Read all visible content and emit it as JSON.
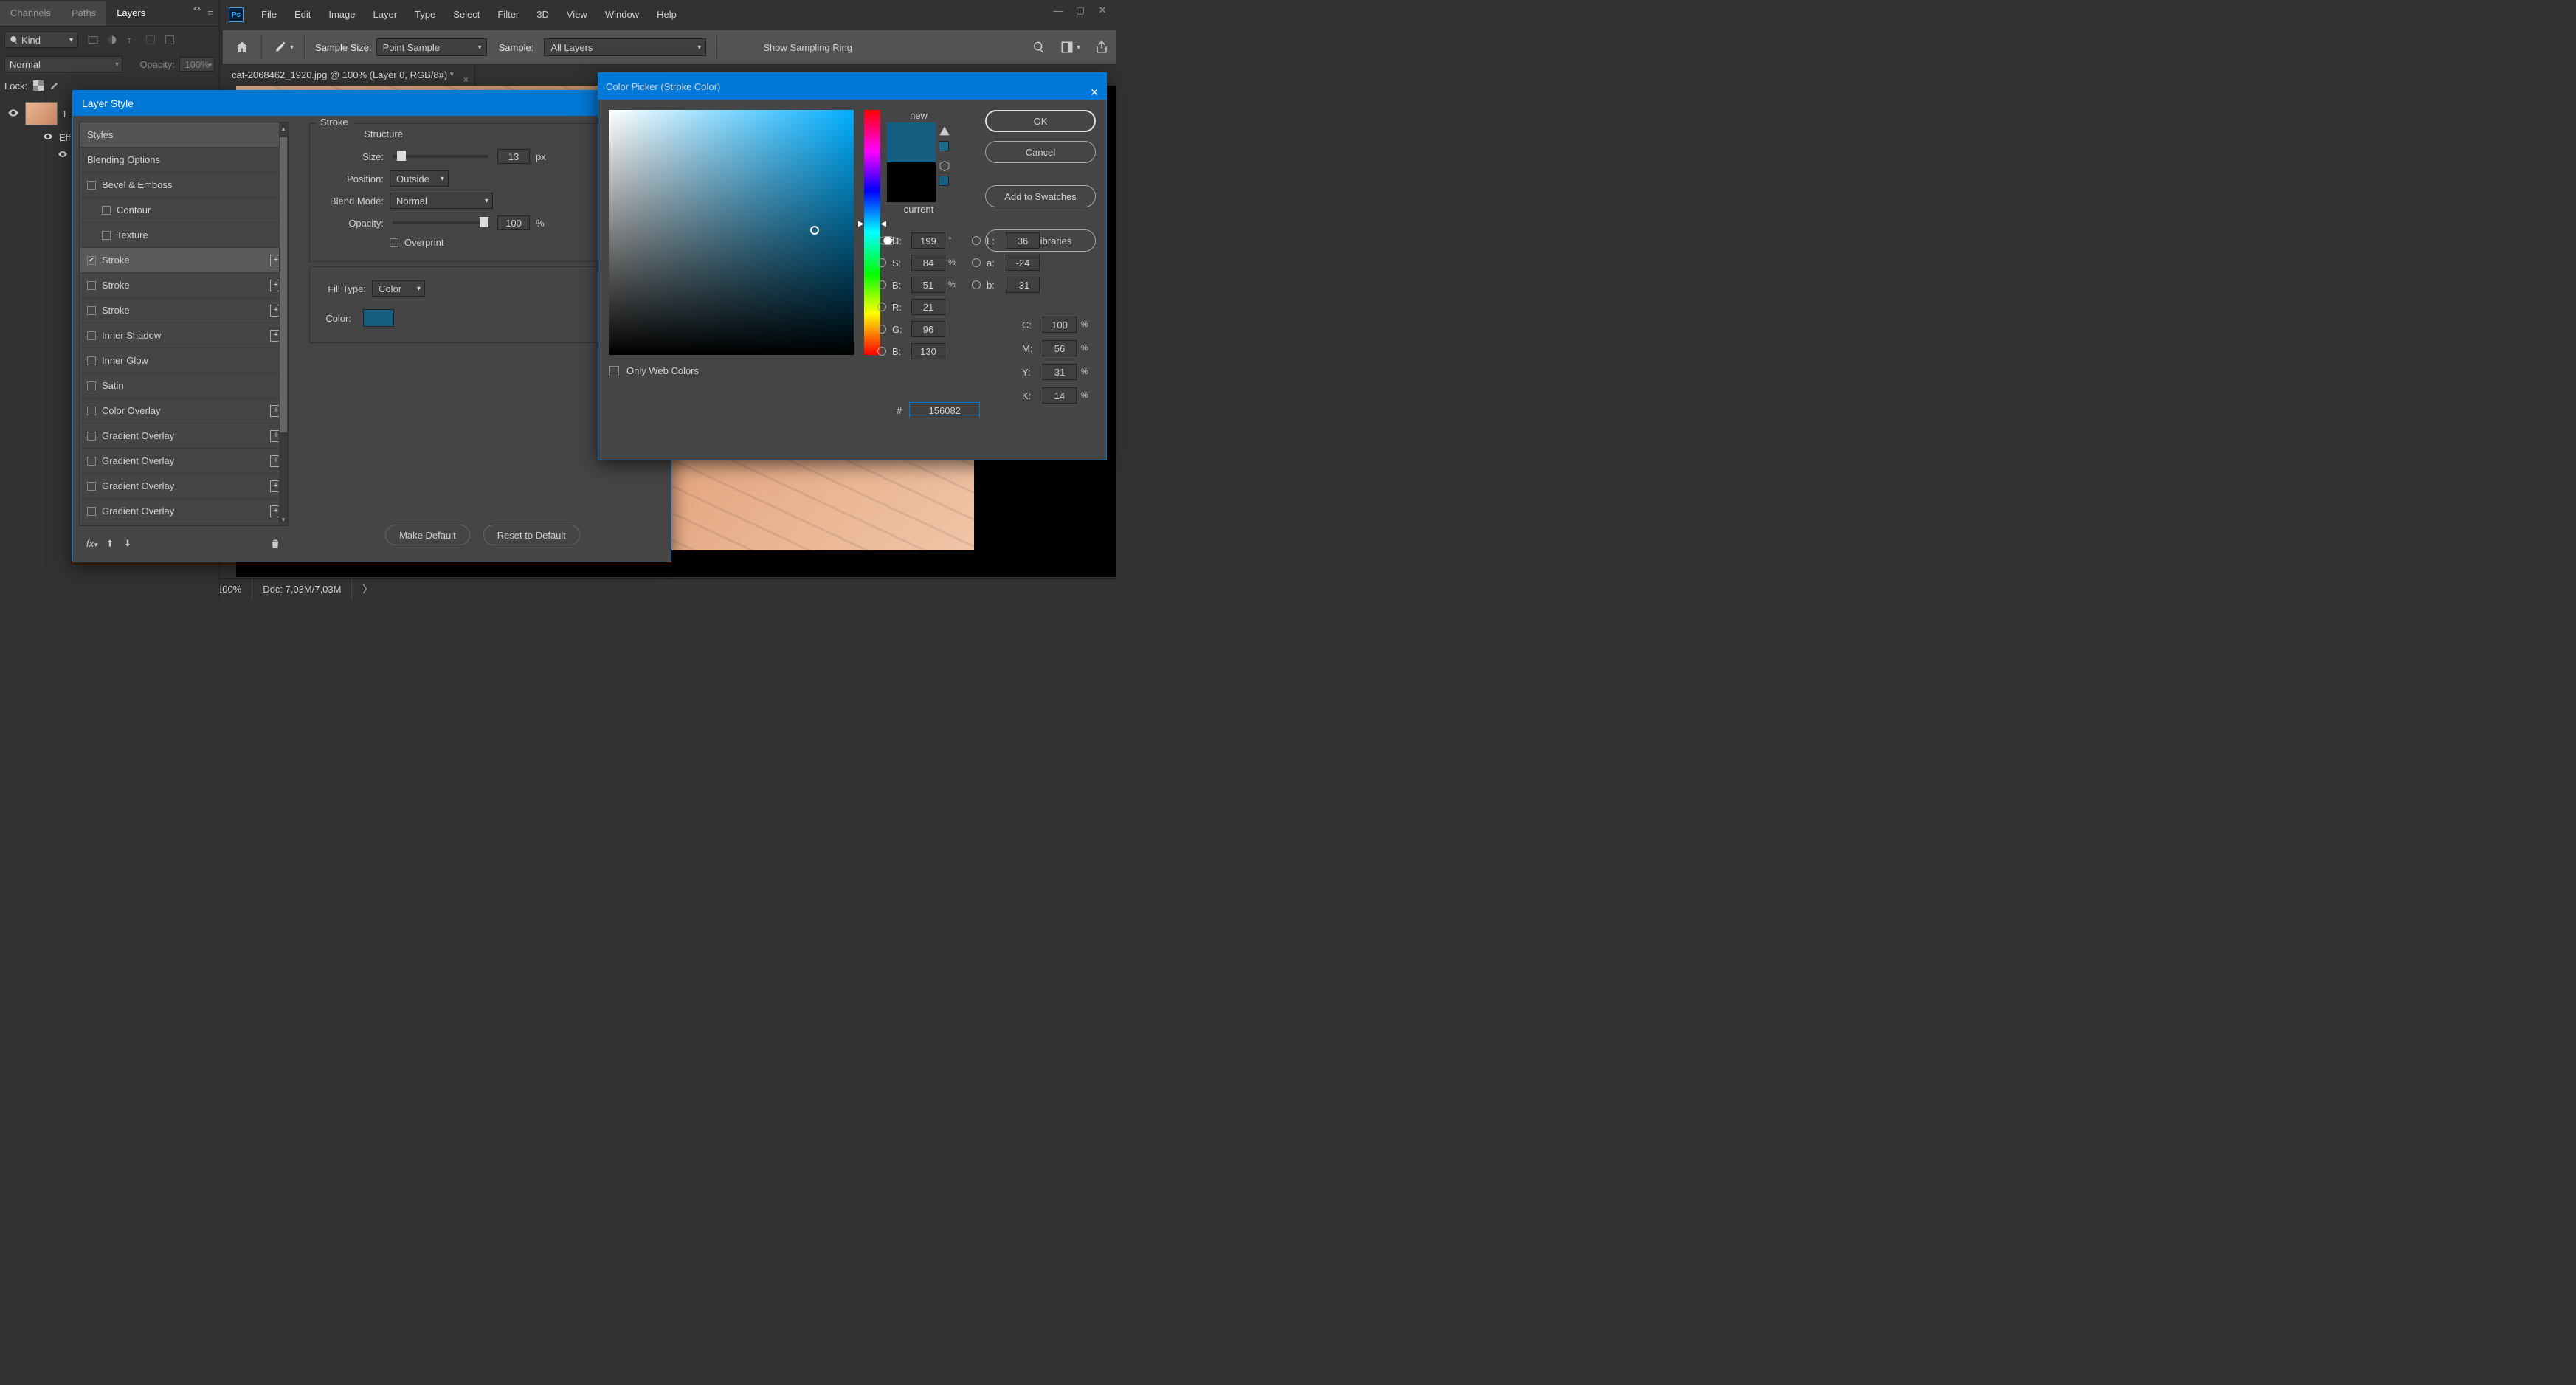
{
  "menu": [
    "File",
    "Edit",
    "Image",
    "Layer",
    "Type",
    "Select",
    "Filter",
    "3D",
    "View",
    "Window",
    "Help"
  ],
  "ps_logo": "Ps",
  "toolbar": {
    "sample_size_label": "Sample Size:",
    "sample_size_value": "Point Sample",
    "sample_label": "Sample:",
    "sample_value": "All Layers",
    "show_ring": "Show Sampling Ring"
  },
  "doc_tab": "cat-2068462_1920.jpg @ 100% (Layer 0, RGB/8#) *",
  "status": {
    "zoom": "100%",
    "docinfo": "Doc: 7,03M/7,03M"
  },
  "panel": {
    "tabs": [
      "Channels",
      "Paths",
      "Layers"
    ],
    "active_tab": "Layers",
    "kind": "Kind",
    "blend_mode": "Normal",
    "opacity_label": "Opacity:",
    "opacity_value": "100%",
    "lock_label": "Lock:",
    "layer0": "L",
    "effects": "Eff",
    "sub_eye": ""
  },
  "layer_style": {
    "title": "Layer Style",
    "stroke_header": "Stroke",
    "structure_header": "Structure",
    "size_label": "Size:",
    "size_value": "13",
    "size_unit": "px",
    "position_label": "Position:",
    "position_value": "Outside",
    "blend_label": "Blend Mode:",
    "blend_value": "Normal",
    "opacity_label": "Opacity:",
    "opacity_value": "100",
    "opacity_unit": "%",
    "overprint": "Overprint",
    "fill_type_label": "Fill Type:",
    "fill_type_value": "Color",
    "color_label": "Color:",
    "make_default": "Make Default",
    "reset_default": "Reset to Default",
    "sidebar": {
      "styles": "Styles",
      "blending_options": "Blending Options",
      "items": [
        {
          "label": "Bevel & Emboss",
          "checked": false,
          "plus": false,
          "indent": false
        },
        {
          "label": "Contour",
          "checked": false,
          "plus": false,
          "indent": true
        },
        {
          "label": "Texture",
          "checked": false,
          "plus": false,
          "indent": true
        },
        {
          "label": "Stroke",
          "checked": true,
          "plus": true,
          "indent": false,
          "active": true
        },
        {
          "label": "Stroke",
          "checked": false,
          "plus": true,
          "indent": false
        },
        {
          "label": "Stroke",
          "checked": false,
          "plus": true,
          "indent": false
        },
        {
          "label": "Inner Shadow",
          "checked": false,
          "plus": true,
          "indent": false
        },
        {
          "label": "Inner Glow",
          "checked": false,
          "plus": false,
          "indent": false
        },
        {
          "label": "Satin",
          "checked": false,
          "plus": false,
          "indent": false
        },
        {
          "label": "Color Overlay",
          "checked": false,
          "plus": true,
          "indent": false
        },
        {
          "label": "Gradient Overlay",
          "checked": false,
          "plus": true,
          "indent": false
        },
        {
          "label": "Gradient Overlay",
          "checked": false,
          "plus": true,
          "indent": false
        },
        {
          "label": "Gradient Overlay",
          "checked": false,
          "plus": true,
          "indent": false
        },
        {
          "label": "Gradient Overlay",
          "checked": false,
          "plus": true,
          "indent": false
        }
      ]
    }
  },
  "color_picker": {
    "title": "Color Picker (Stroke Color)",
    "new_label": "new",
    "current_label": "current",
    "new_color": "#156082",
    "current_color": "#000000",
    "ok": "OK",
    "cancel": "Cancel",
    "add_swatches": "Add to Swatches",
    "color_libraries": "Color Libraries",
    "web_only": "Only Web Colors",
    "H": "199",
    "S": "84",
    "Bv": "51",
    "L": "36",
    "a": "-24",
    "b": "-31",
    "R": "21",
    "G": "96",
    "Bc": "130",
    "C": "100",
    "M": "56",
    "Y": "31",
    "K": "14",
    "hex": "156082",
    "labels": {
      "H": "H:",
      "S": "S:",
      "B": "B:",
      "L": "L:",
      "a": "a:",
      "b": "b:",
      "R": "R:",
      "G": "G:",
      "Bc": "B:",
      "C": "C:",
      "M": "M:",
      "Y": "Y:",
      "K": "K:",
      "hash": "#"
    }
  }
}
